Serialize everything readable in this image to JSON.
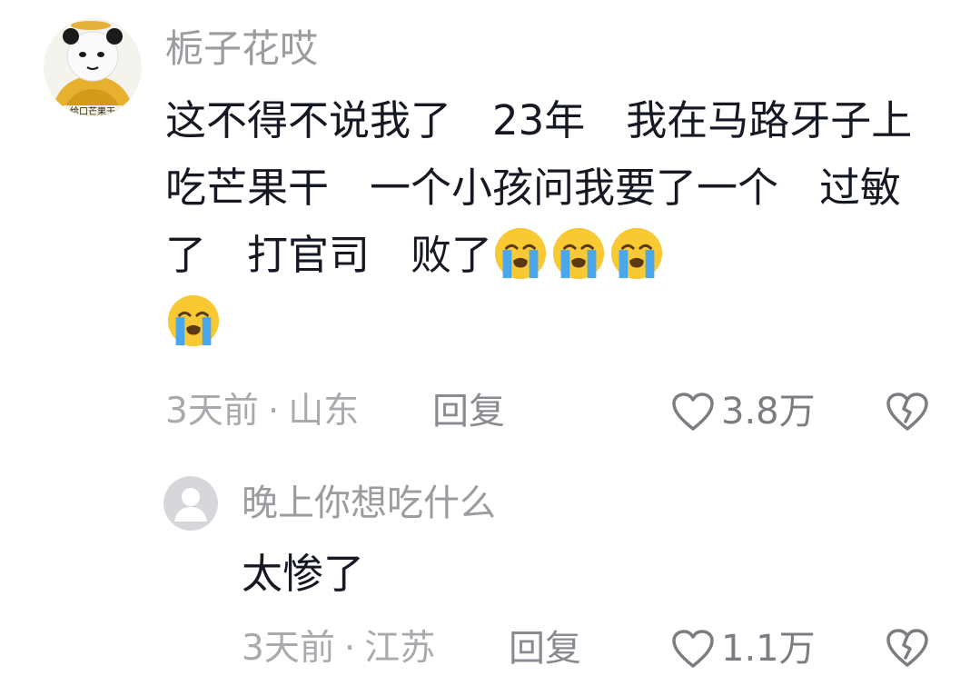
{
  "main_comment": {
    "username": "栀子花哎",
    "avatar_icon": "panda-meme-avatar",
    "text": "这不得不说我了　23年　我在马路牙子上吃芒果干　一个小孩问我要了一个　过敏了　打官司　败了",
    "emoji": [
      "loudly-crying-face",
      "loudly-crying-face",
      "loudly-crying-face",
      "loudly-crying-face"
    ],
    "time": "3天前",
    "dot": "·",
    "location": "山东",
    "reply_label": "回复",
    "likes": "3.8万"
  },
  "reply_comment": {
    "username": "晚上你想吃什么",
    "avatar_icon": "default-user-avatar",
    "text": "太惨了",
    "time": "3天前",
    "dot": "·",
    "location": "江苏",
    "reply_label": "回复",
    "likes": "1.1万"
  },
  "colors": {
    "text": "#161823",
    "muted": "#a9a9ae",
    "emoji_face": "#f9c934",
    "emoji_tears": "#4aa7ec"
  }
}
